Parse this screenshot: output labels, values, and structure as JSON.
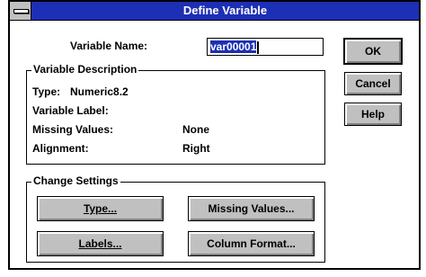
{
  "dialog": {
    "title": "Define Variable"
  },
  "variable_name": {
    "label": "Variable Name:",
    "value": "var00001"
  },
  "side_buttons": {
    "ok": "OK",
    "cancel": "Cancel",
    "help": "Help"
  },
  "description": {
    "title": "Variable Description",
    "type_label": "Type:",
    "type_value": "Numeric8.2",
    "variable_label_label": "Variable Label:",
    "missing_values_label": "Missing Values:",
    "missing_values_value": "None",
    "alignment_label": "Alignment:",
    "alignment_value": "Right"
  },
  "change_settings": {
    "title": "Change Settings",
    "type_button": "Type...",
    "missing_values_button": "Missing Values...",
    "labels_button": "Labels...",
    "column_format_button": "Column Format..."
  },
  "colors": {
    "titlebar": "#1d2fb5",
    "button_face": "#c0c0c0"
  }
}
